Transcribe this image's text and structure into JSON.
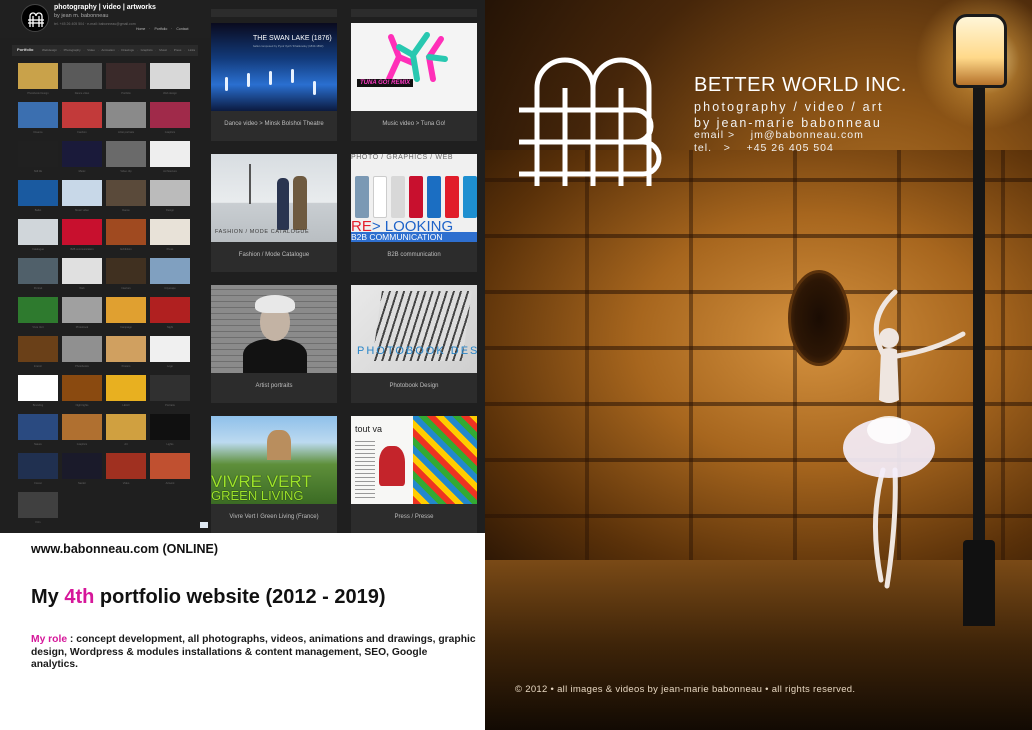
{
  "site": {
    "header": {
      "name": "photography | video | artworks",
      "by": "by jean m. babonneau",
      "contact": "tel. +45 26 405 504 · e-mail: babonneau@gmail.com",
      "mini_nav": "Home · Portfolio · Contact"
    },
    "navbar": {
      "home": "Portfolio",
      "items": "Webdesign · Photography · Video · Animation · Drawings · Graphics · Music · Press · Links"
    },
    "thumbnails": [
      "Photobook Design",
      "Dance video",
      "Portfolio",
      "Web design",
      "Dreams",
      "Fashion",
      "Artist portraits",
      "Graphics",
      "Still life",
      "Music",
      "Video clip",
      "Architecture",
      "Ballet",
      "Music video",
      "Dance",
      "Design",
      "Catalogue",
      "B2B communication",
      "Exhibition",
      "Press",
      "Portrait",
      "Web",
      "Interiors",
      "Cityscape",
      "Vivre Vert",
      "Photobook",
      "Campaign",
      "Night",
      "Interior",
      "Photobooks",
      "Posters",
      "Logo",
      "Branding",
      "Night lights",
      "LEGO",
      "Portraits",
      "Nature",
      "Graphics",
      "Art",
      "Lights",
      "Forest",
      "Nardor",
      "Video",
      "Artwork",
      "Film"
    ],
    "cards": {
      "swan": {
        "label": "Dance video > Minsk Bolshoi Theatre",
        "title": "THE SWAN LAKE (1876)",
        "subtitle": "ballet composed by Pyotr Ilyich Tchaikovsky (1840-1893)"
      },
      "tuna": {
        "label": "Music video > Tuna Go!",
        "banner": "TUNA GO! REMIX"
      },
      "fashion": {
        "label": "Fashion / Mode Catalogue",
        "overlay": "FASHION / MODE CATALOGUE"
      },
      "b2b": {
        "label": "B2B communication",
        "top": "PHOTO / GRAPHICS / WEB",
        "relook_red": "RE",
        "relook_blue": "> LOOKING",
        "b2b": "B2B COMMUNICATION"
      },
      "artist": {
        "label": "Artist portraits"
      },
      "photobook": {
        "label": "Photobook Design",
        "overlay": "PHOTOBOOK DESIGN"
      },
      "vivre": {
        "label": "Vivre Vert I Green Living (France)",
        "line1": "VIVRE VERT",
        "line2": "GREEN LIVING"
      },
      "press": {
        "label": "Press / Presse",
        "headline": "tout va"
      }
    }
  },
  "description": {
    "url": "www.babonneau.com (ONLINE)",
    "headline_pre": "My ",
    "headline_highlight": "4th",
    "headline_post": " portfolio website (2012 - 2019)",
    "role_label": "My role",
    "role_text": " : concept development, all photographs, videos, animations and drawings, graphic design, Wordpress & modules installations & content management, SEO, Google analytics."
  },
  "hero": {
    "brand_name": "BETTER WORLD INC.",
    "tagline": "photography / video / art",
    "byline": "by jean-marie babonneau",
    "email": "email >    jm@babonneau.com",
    "tel": "tel.   >    +45 26 405 504",
    "copyright": "© 2012 • all images & videos by jean-marie babonneau • all rights reserved."
  },
  "colors": {
    "accent": "#d6179a",
    "site_bg": "#1f1f1f",
    "card_bg": "#2c2c2c"
  }
}
